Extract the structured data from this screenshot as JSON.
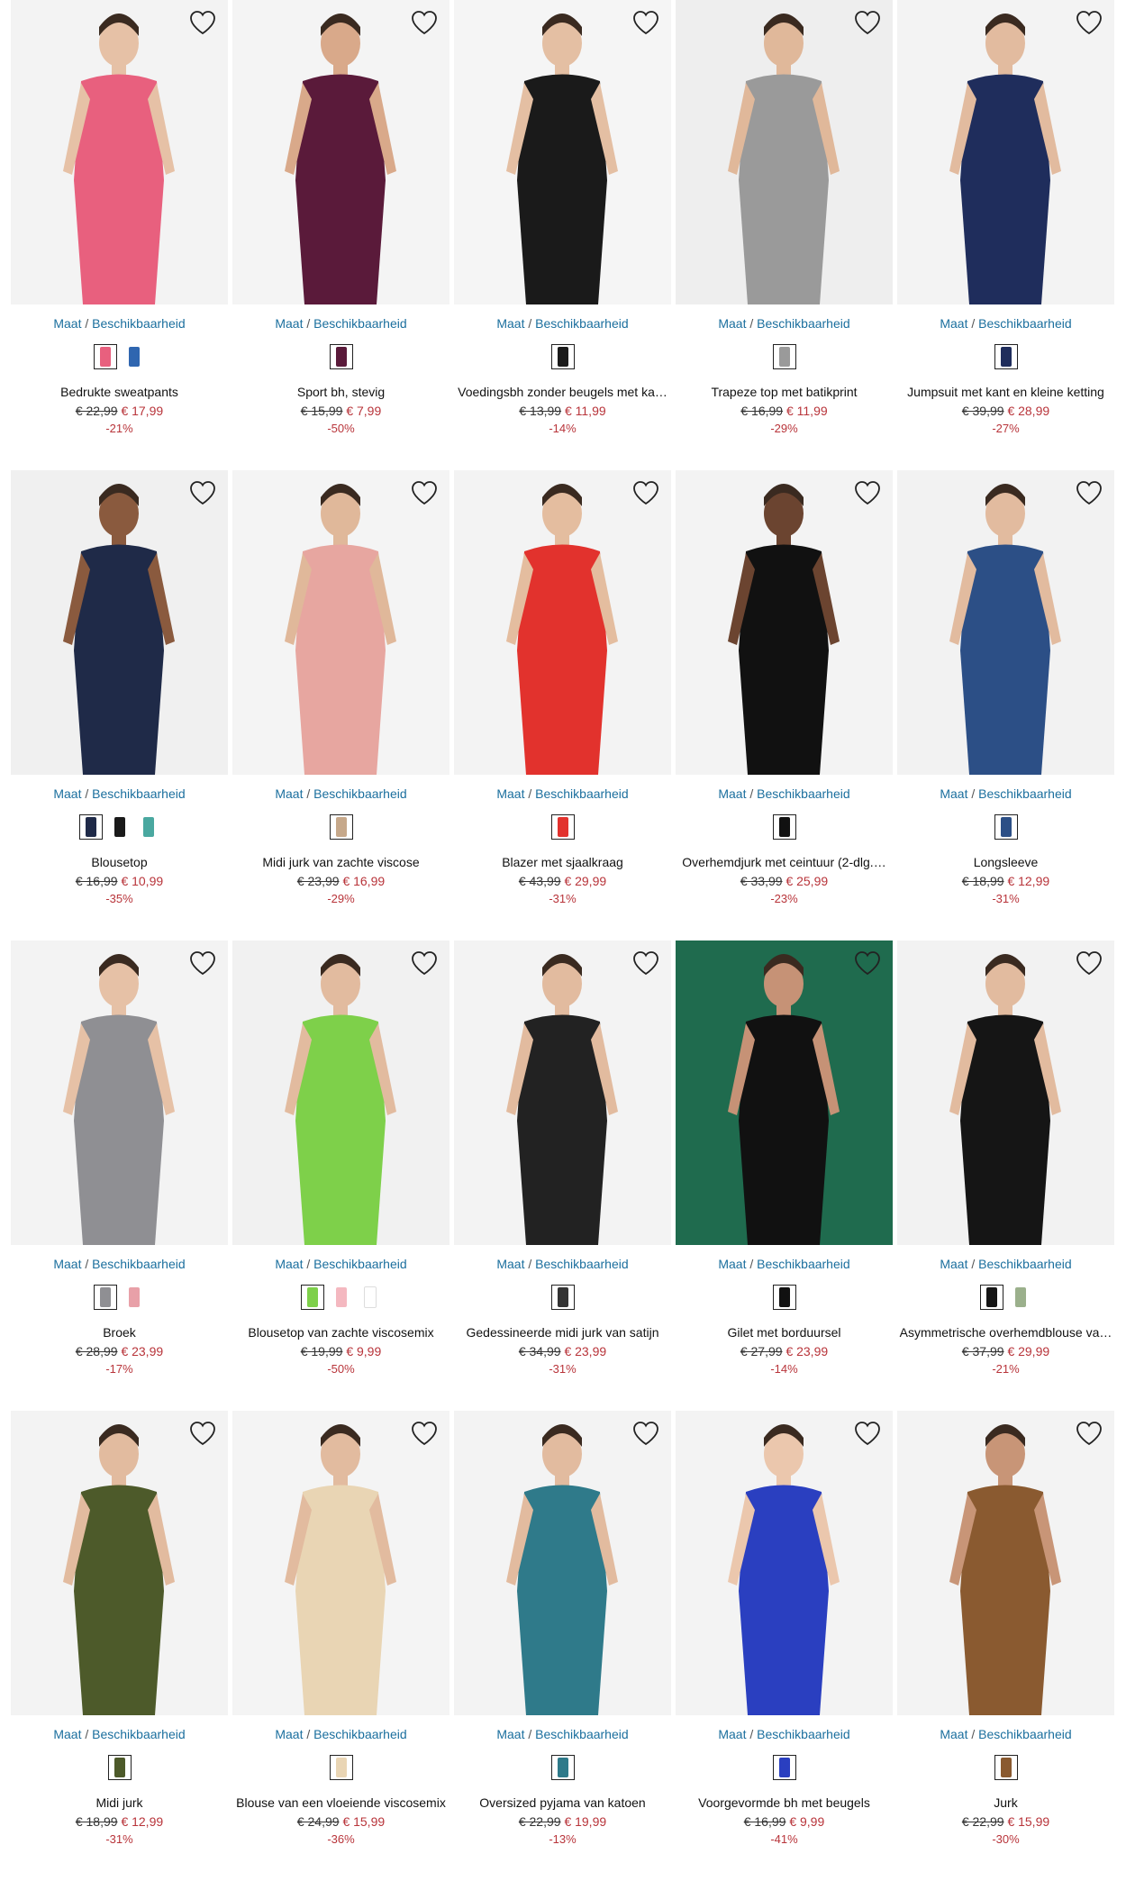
{
  "availability_label": "Maat",
  "availability_sep": "/",
  "availability_label2": "Beschikbaarheid",
  "colors": {
    "link": "#1b6f9e",
    "sale": "#b8343a"
  },
  "products": [
    {
      "title": "Bedrukte sweatpants",
      "old_price": "€ 22,99",
      "new_price": "€ 17,99",
      "discount": "-21%",
      "bg": "#f3f3f3",
      "garment": "#e8607e",
      "skin": "#e6c1a6",
      "swatches": [
        "#e8607e",
        "#2f66b0"
      ]
    },
    {
      "title": "Sport bh, stevig",
      "old_price": "€ 15,99",
      "new_price": "€ 7,99",
      "discount": "-50%",
      "bg": "#f4f4f4",
      "garment": "#5a1a3a",
      "skin": "#d9a98a",
      "swatches": [
        "#5a1a3a"
      ]
    },
    {
      "title": "Voedingsbh zonder beugels met ka…",
      "old_price": "€ 13,99",
      "new_price": "€ 11,99",
      "discount": "-14%",
      "bg": "#f5f5f5",
      "garment": "#1a1a1a",
      "skin": "#e4bfa3",
      "swatches": [
        "#1a1a1a"
      ]
    },
    {
      "title": "Trapeze top met batikprint",
      "old_price": "€ 16,99",
      "new_price": "€ 11,99",
      "discount": "-29%",
      "bg": "#eeeeee",
      "garment": "#9a9a9a",
      "skin": "#e0b89a",
      "swatches": [
        "#9a9a9a"
      ]
    },
    {
      "title": "Jumpsuit met kant en kleine ketting",
      "old_price": "€ 39,99",
      "new_price": "€ 28,99",
      "discount": "-27%",
      "bg": "#f3f3f3",
      "garment": "#1f2d5c",
      "skin": "#e2bb9f",
      "swatches": [
        "#1f2d5c"
      ]
    },
    {
      "title": "Blousetop",
      "old_price": "€ 16,99",
      "new_price": "€ 10,99",
      "discount": "-35%",
      "bg": "#f0f0f0",
      "garment": "#1f2a48",
      "skin": "#8a5a3e",
      "swatches": [
        "#1f2a48",
        "#1a1a1a",
        "#4aa8a0"
      ]
    },
    {
      "title": "Midi jurk van zachte viscose",
      "old_price": "€ 23,99",
      "new_price": "€ 16,99",
      "discount": "-29%",
      "bg": "#f4f4f4",
      "garment": "#e7a6a0",
      "skin": "#e0b89a",
      "swatches": [
        "#c6a88a"
      ]
    },
    {
      "title": "Blazer met sjaalkraag",
      "old_price": "€ 43,99",
      "new_price": "€ 29,99",
      "discount": "-31%",
      "bg": "#f3f3f3",
      "garment": "#e2322d",
      "skin": "#e4bd9f",
      "swatches": [
        "#e2322d"
      ]
    },
    {
      "title": "Overhemdjurk met ceintuur (2-dlg.…",
      "old_price": "€ 33,99",
      "new_price": "€ 25,99",
      "discount": "-23%",
      "bg": "#f3f3f3",
      "garment": "#111111",
      "skin": "#6b4430",
      "swatches": [
        "#111111"
      ]
    },
    {
      "title": "Longsleeve",
      "old_price": "€ 18,99",
      "new_price": "€ 12,99",
      "discount": "-31%",
      "bg": "#f2f2f2",
      "garment": "#2c4f86",
      "skin": "#e2bb9f",
      "swatches": [
        "#2c4f86"
      ]
    },
    {
      "title": "Broek",
      "old_price": "€ 28,99",
      "new_price": "€ 23,99",
      "discount": "-17%",
      "bg": "#f3f3f3",
      "garment": "#8f8f93",
      "skin": "#e6c1a6",
      "swatches": [
        "#8f8f93",
        "#e8a0a8"
      ]
    },
    {
      "title": "Blousetop van zachte viscosemix",
      "old_price": "€ 19,99",
      "new_price": "€ 9,99",
      "discount": "-50%",
      "bg": "#f1f1f1",
      "garment": "#7ed04a",
      "skin": "#e2bb9f",
      "swatches": [
        "#7ed04a",
        "#f4b8c0",
        "#ffffff"
      ]
    },
    {
      "title": "Gedessineerde midi jurk van satijn",
      "old_price": "€ 34,99",
      "new_price": "€ 23,99",
      "discount": "-31%",
      "bg": "#f3f3f3",
      "garment": "#222222",
      "skin": "#e2bb9f",
      "swatches": [
        "#333333"
      ]
    },
    {
      "title": "Gilet met borduursel",
      "old_price": "€ 27,99",
      "new_price": "€ 23,99",
      "discount": "-14%",
      "bg": "#1f6b4e",
      "garment": "#111111",
      "skin": "#c69276",
      "swatches": [
        "#111111"
      ]
    },
    {
      "title": "Asymmetrische overhemdblouse va…",
      "old_price": "€ 37,99",
      "new_price": "€ 29,99",
      "discount": "-21%",
      "bg": "#f2f2f2",
      "garment": "#151515",
      "skin": "#e2bb9f",
      "swatches": [
        "#151515",
        "#9bb08c"
      ]
    },
    {
      "title": "Midi jurk",
      "old_price": "€ 18,99",
      "new_price": "€ 12,99",
      "discount": "-31%",
      "bg": "#f3f3f3",
      "garment": "#4d5a2a",
      "skin": "#e2bb9f",
      "swatches": [
        "#4d5a2a"
      ]
    },
    {
      "title": "Blouse van een vloeiende viscosemix",
      "old_price": "€ 24,99",
      "new_price": "€ 15,99",
      "discount": "-36%",
      "bg": "#f4f4f4",
      "garment": "#e9d5b4",
      "skin": "#e2bb9f",
      "swatches": [
        "#e9d5b4"
      ]
    },
    {
      "title": "Oversized pyjama van katoen",
      "old_price": "€ 22,99",
      "new_price": "€ 19,99",
      "discount": "-13%",
      "bg": "#f3f3f3",
      "garment": "#2f7a8a",
      "skin": "#e2bb9f",
      "swatches": [
        "#2f7a8a"
      ]
    },
    {
      "title": "Voorgevormde bh met beugels",
      "old_price": "€ 16,99",
      "new_price": "€ 9,99",
      "discount": "-41%",
      "bg": "#f3f3f3",
      "garment": "#2a3fc0",
      "skin": "#ebc7ad",
      "swatches": [
        "#2a3fc0"
      ]
    },
    {
      "title": "Jurk",
      "old_price": "€ 22,99",
      "new_price": "€ 15,99",
      "discount": "-30%",
      "bg": "#f3f3f3",
      "garment": "#8a5a30",
      "skin": "#c89577",
      "swatches": [
        "#8a5a30"
      ]
    }
  ]
}
